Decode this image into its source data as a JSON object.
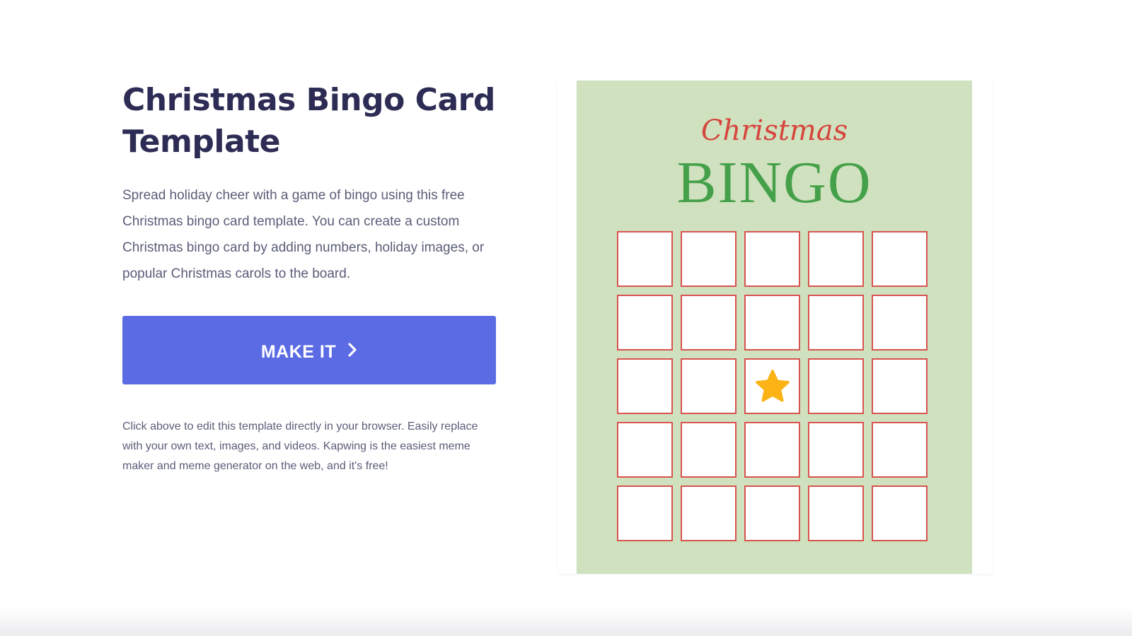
{
  "hero": {
    "title_line1": "Christmas Bingo Card",
    "title_line2": "Template",
    "description": "Spread holiday cheer with a game of bingo using this free Christmas bingo card template. You can create a custom Christmas bingo card by adding numbers, holiday images, or popular Christmas carols to the board.",
    "make_it_label": "MAKE IT",
    "make_it_icon": "chevron-right-icon",
    "footnote": "Click above to edit this template directly in your browser. Easily replace with your own text, images, and videos. Kapwing is the easiest meme maker and meme generator on the web, and it's free!"
  },
  "template_preview": {
    "script_title": "Christmas",
    "bingo_title": "BINGO",
    "grid_rows": 5,
    "grid_cols": 5,
    "center_icon": "star-icon",
    "colors": {
      "background": "#cfe1bf",
      "script_title": "#d6453c",
      "bingo_title": "#45a04a",
      "cell_border": "#d9534f",
      "star": "#fbb316"
    }
  },
  "colors": {
    "title": "#2d2c54",
    "body_text": "#5a5d78",
    "button": "#5b6be3"
  }
}
